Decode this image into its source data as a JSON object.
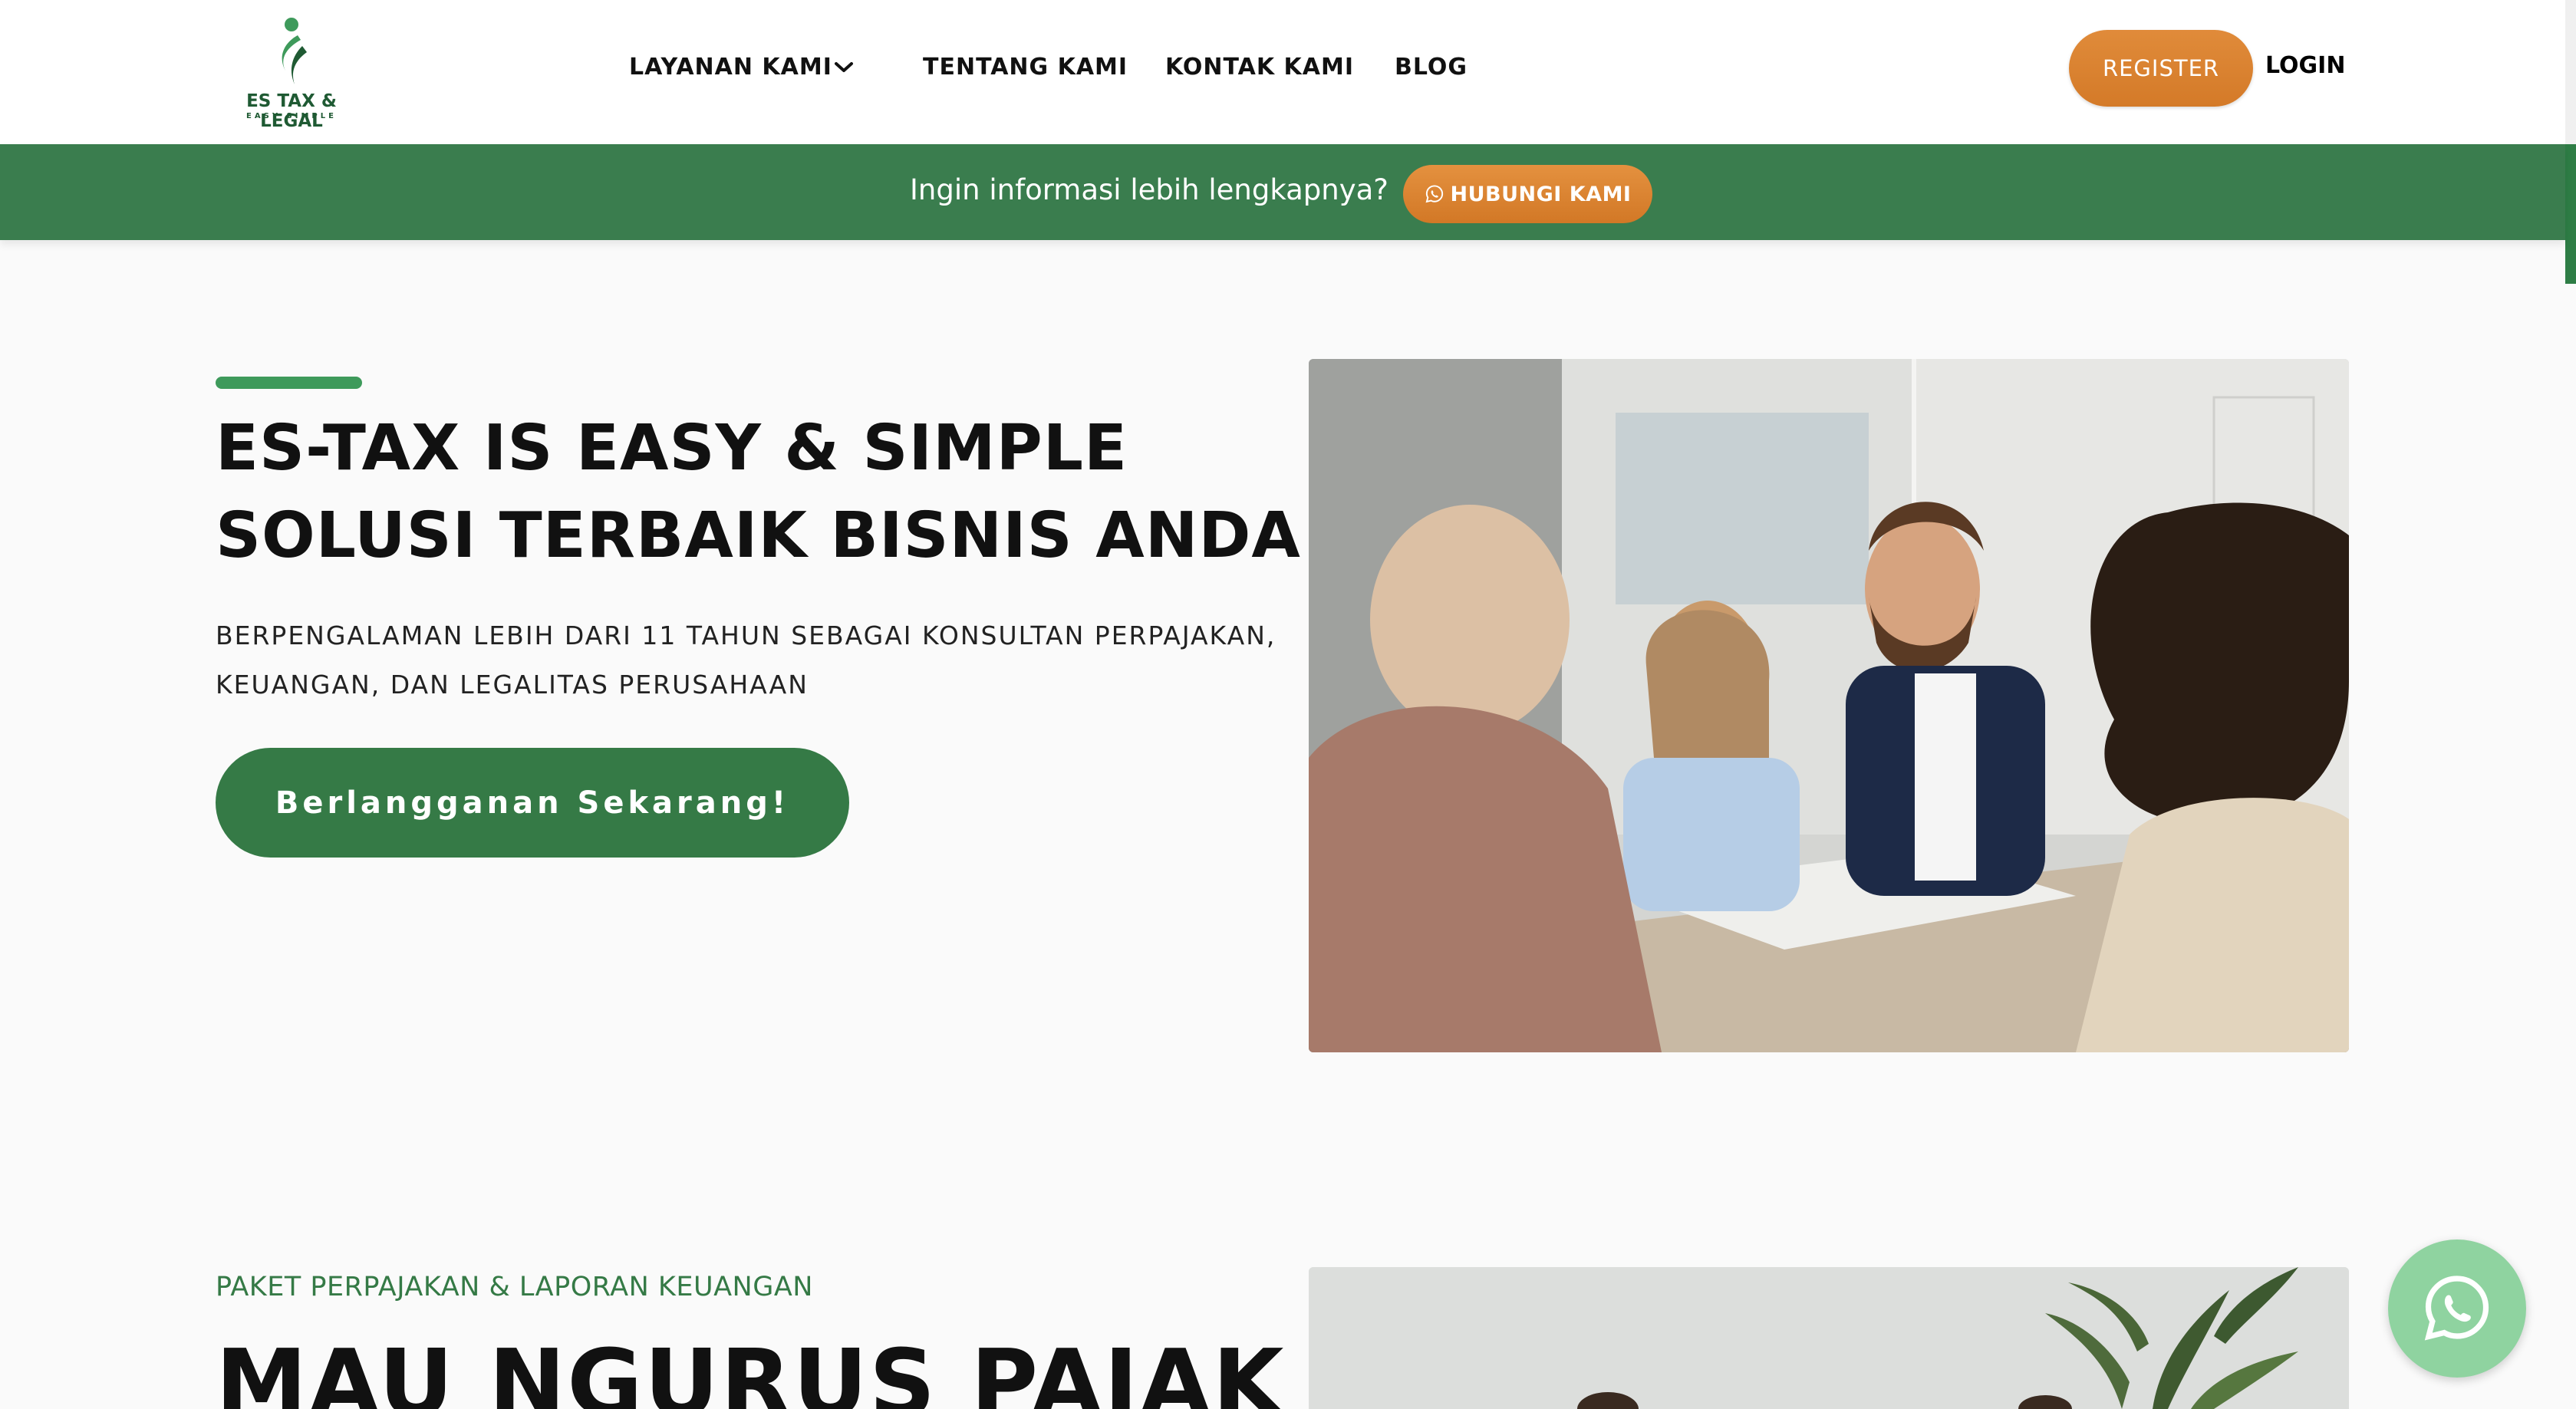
{
  "header": {
    "logo": {
      "name": "ES TAX & LEGAL",
      "tagline": "EASY SIMPLE",
      "icon": "leaf-figure-logo"
    },
    "nav": [
      {
        "label": "LAYANAN KAMI",
        "icon": "chevron-down-icon"
      },
      {
        "label": "TENTANG KAMI"
      },
      {
        "label": "KONTAK KAMI"
      },
      {
        "label": "BLOG"
      }
    ],
    "register_label": "REGISTER",
    "login_label": "LOGIN"
  },
  "banner": {
    "text": "Ingin informasi lebih lengkapnya?",
    "button_label": "HUBUNGI KAMI",
    "button_icon": "whatsapp-icon"
  },
  "hero": {
    "title_lines": [
      "ES-TAX IS EASY & SIMPLE",
      "SOLUSI TERBAIK BISNIS ANDA!"
    ],
    "subtitle_lines": [
      "BERPENGALAMAN LEBIH DARI 11 TAHUN SEBAGAI KONSULTAN PERPAJAKAN,",
      "KEUANGAN, DAN LEGALITAS PERUSAHAAN"
    ],
    "cta_label": "Berlangganan Sekarang!"
  },
  "section2": {
    "label": "PAKET PERPAJAKAN & LAPORAN KEUANGAN",
    "title": "MAU NGURUS PAJAK"
  },
  "floating": {
    "icon": "whatsapp-icon"
  },
  "colors": {
    "brand_green": "#357a46",
    "banner_green": "#3a7d4e",
    "accent_orange": "#d9822f",
    "whatsapp_float": "#8fd3a0"
  }
}
